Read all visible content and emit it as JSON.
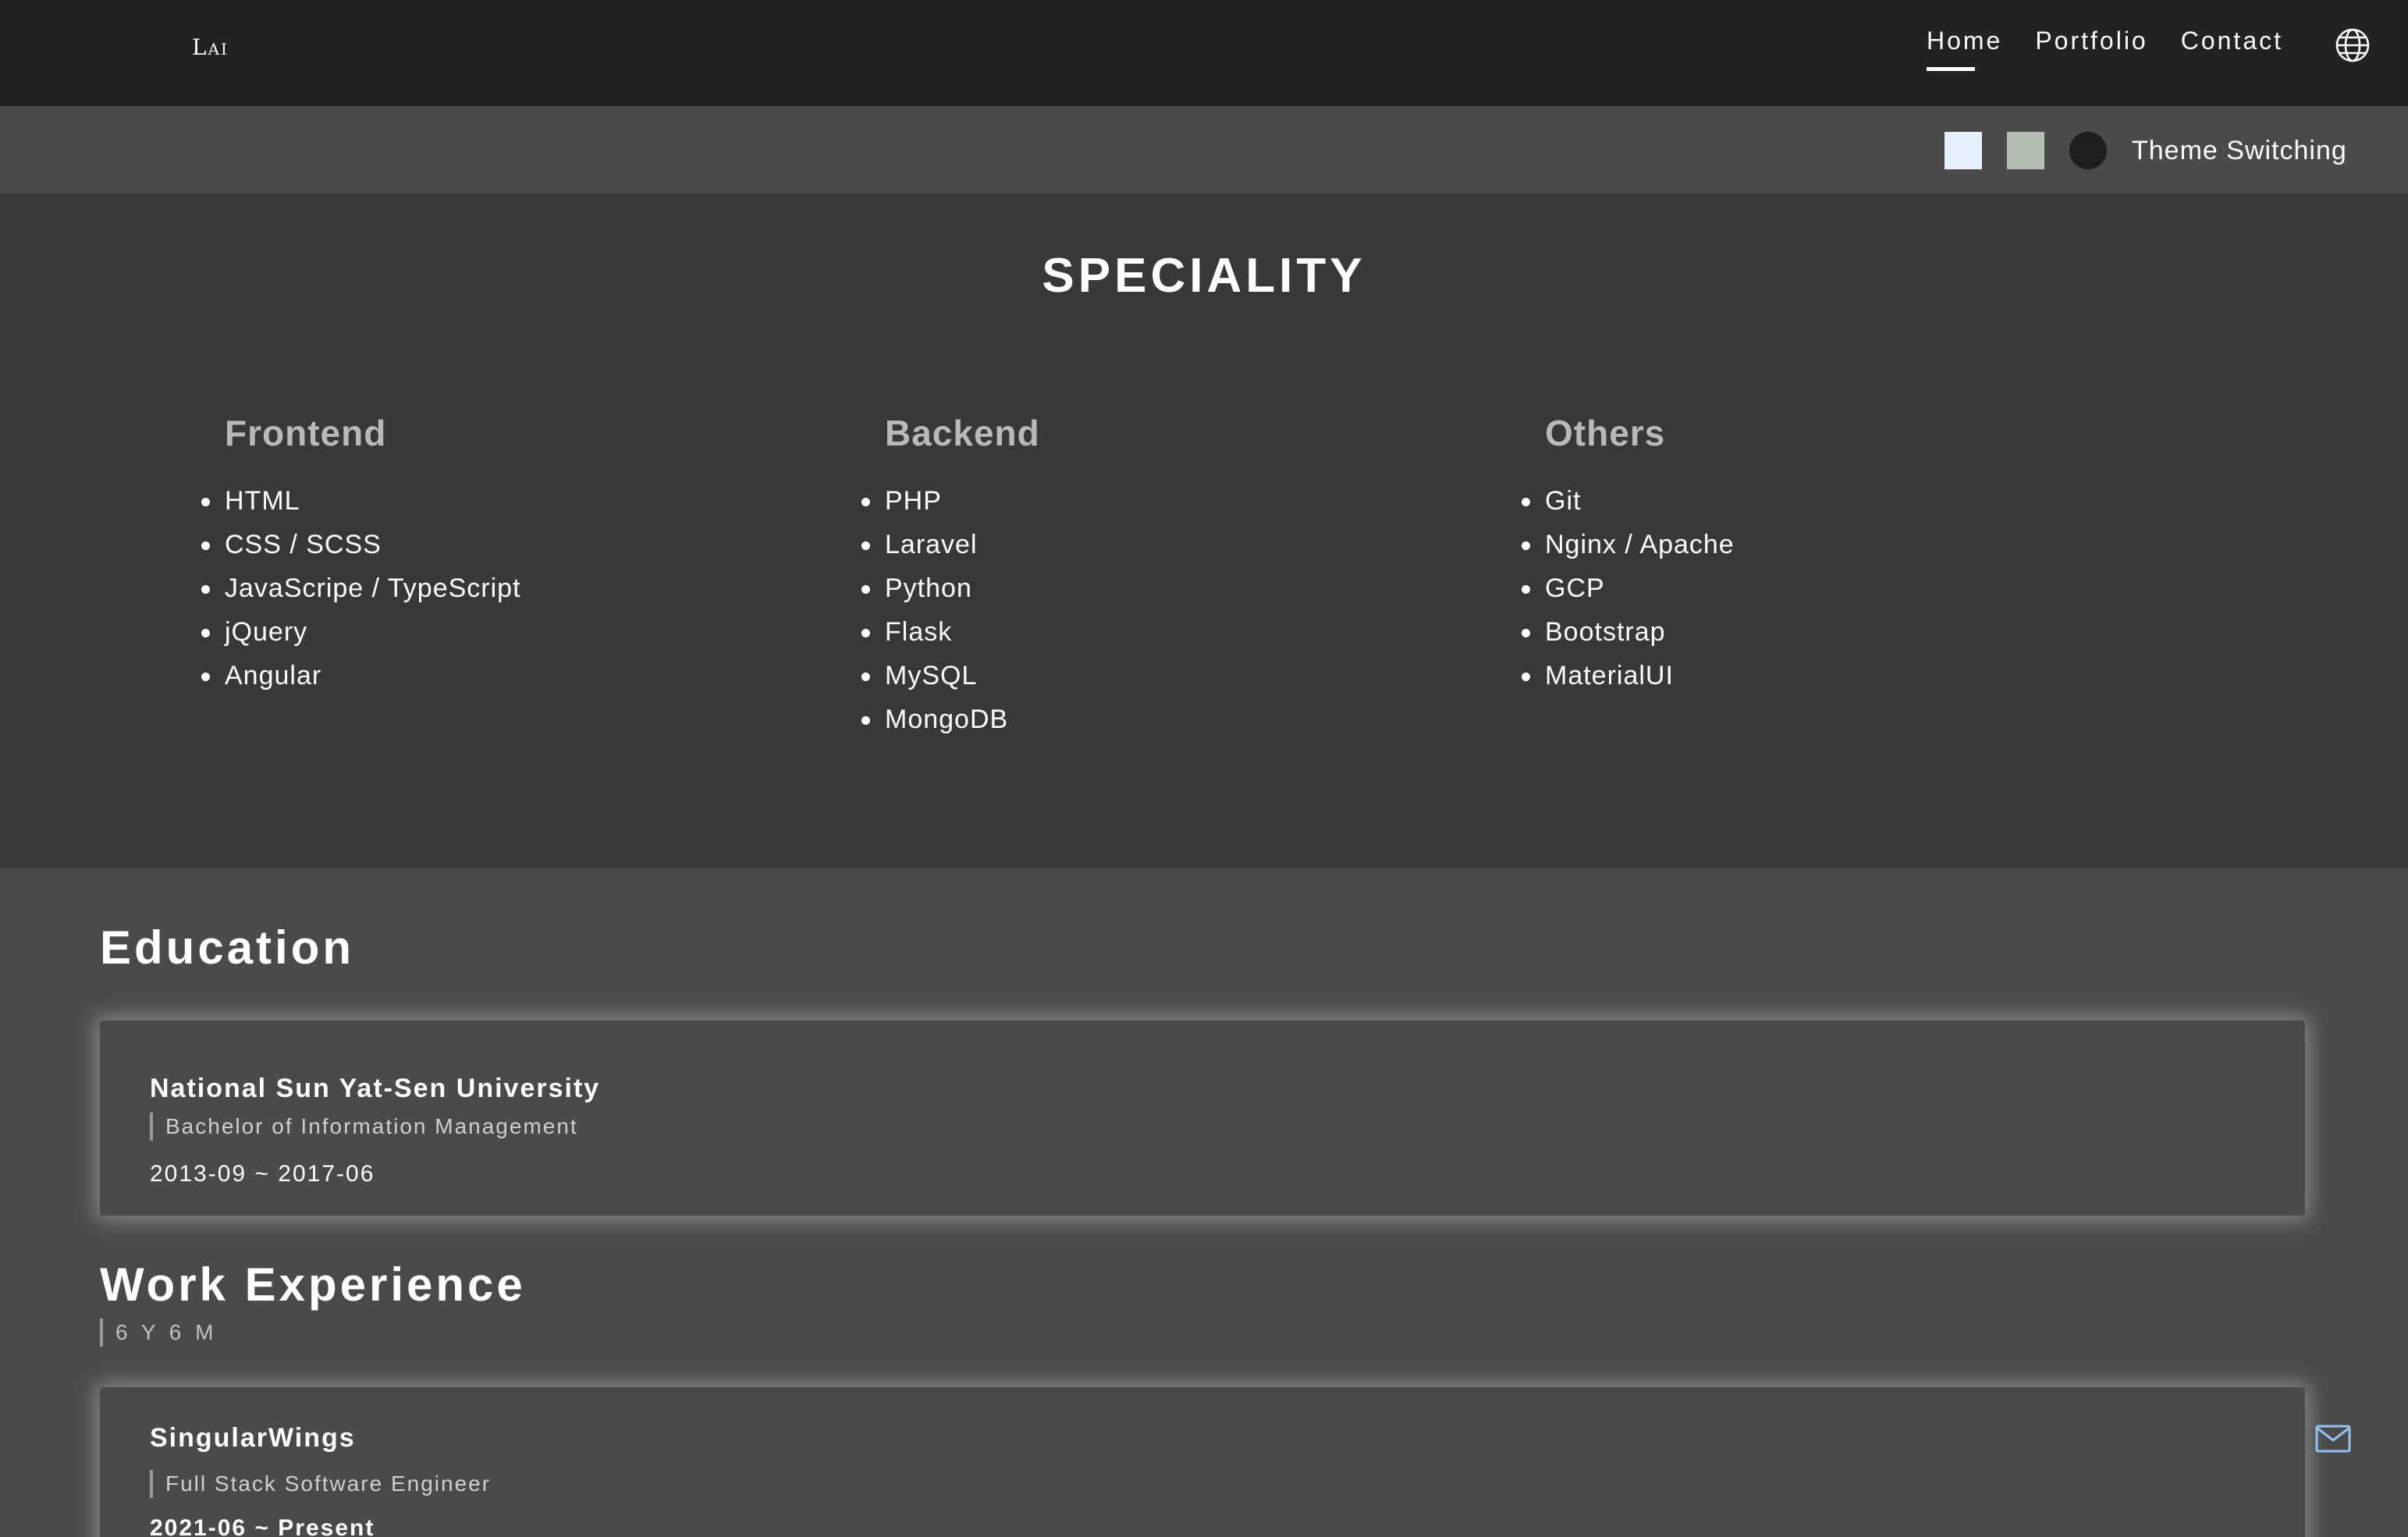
{
  "nav": {
    "logo": "Lai",
    "links": [
      "Home",
      "Portfolio",
      "Contact"
    ],
    "active": "Home",
    "language_icon": "globe-icon"
  },
  "theme": {
    "label": "Theme Switching",
    "swatches": [
      "#e6f1fd",
      "#b4beb3",
      "#1e1e1e"
    ]
  },
  "speciality": {
    "title": "SPECIALITY",
    "columns": [
      {
        "title": "Frontend",
        "items": [
          "HTML",
          "CSS / SCSS",
          "JavaScripe / TypeScript",
          "jQuery",
          "Angular"
        ]
      },
      {
        "title": "Backend",
        "items": [
          "PHP",
          "Laravel",
          "Python",
          "Flask",
          "MySQL",
          "MongoDB"
        ]
      },
      {
        "title": "Others",
        "items": [
          "Git",
          "Nginx / Apache",
          "GCP",
          "Bootstrap",
          "MaterialUI"
        ]
      }
    ]
  },
  "education": {
    "title": "Education",
    "school": "National Sun Yat-Sen University",
    "degree": "Bachelor of Information Management",
    "period": "2013-09 ~ 2017-06"
  },
  "work": {
    "title": "Work Experience",
    "total": "6 Y 6 M",
    "company": "SingularWings",
    "role": "Full Stack Software Engineer",
    "period": "2021-06 ~ Present"
  },
  "contact_icon": "mail-icon"
}
